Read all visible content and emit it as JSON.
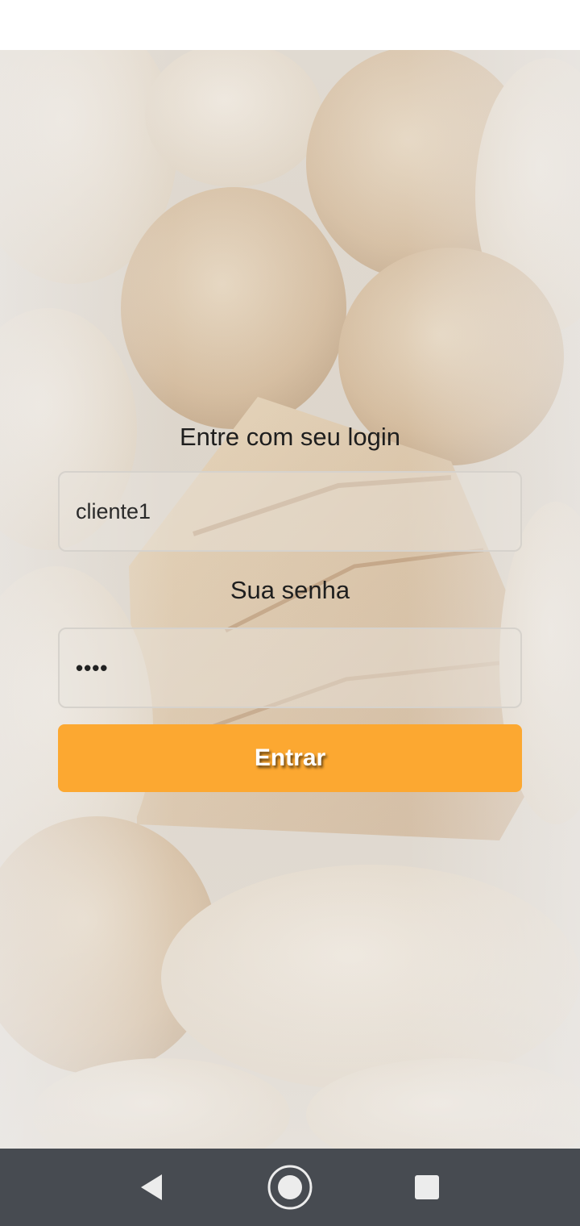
{
  "login": {
    "username_label": "Entre com seu login",
    "username_value": "cliente1",
    "password_label": "Sua senha",
    "password_masked": "••••",
    "submit_label": "Entrar"
  },
  "colors": {
    "accent": "#fca831",
    "nav_bar": "#474b51",
    "status_bar": "#ffffff"
  },
  "nav": {
    "icons": [
      "back-icon",
      "home-icon",
      "recents-icon"
    ]
  }
}
